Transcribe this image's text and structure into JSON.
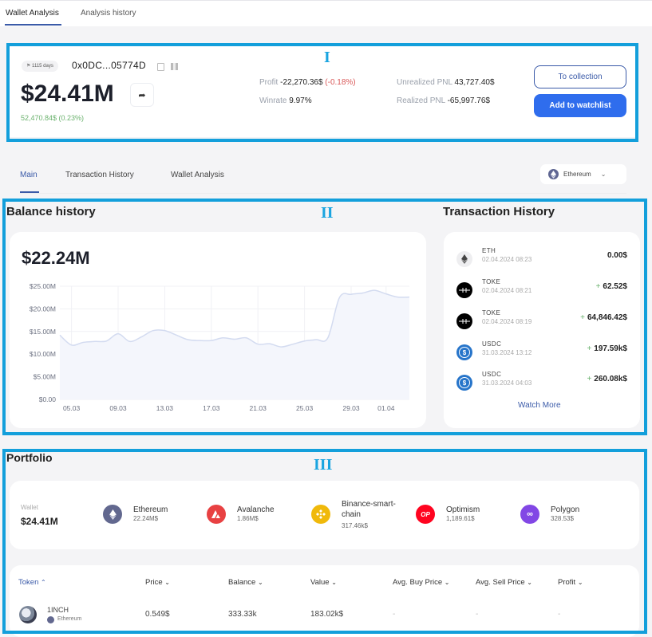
{
  "top_tabs": [
    {
      "label": "Wallet Analysis",
      "active": true
    },
    {
      "label": "Analysis history",
      "active": false
    }
  ],
  "annotations": {
    "section1": "I",
    "section2": "II",
    "section3": "III"
  },
  "wallet": {
    "age_badge": "1115 days",
    "address": "0x0DC...05774D",
    "balance": "$24.41M",
    "change": "52,470.84$ (0.23%)",
    "profit_label": "Profit",
    "profit_value": "-22,270.36$",
    "profit_pct": "(-0.18%)",
    "winrate_label": "Winrate",
    "winrate_value": "9.97%",
    "unrealized_label": "Unrealized PNL",
    "unrealized_value": "43,727.40$",
    "realized_label": "Realized PNL",
    "realized_value": "-65,997.76$",
    "to_collection": "To collection",
    "add_watchlist": "Add to watchlist"
  },
  "sub_tabs": [
    {
      "label": "Main",
      "active": true
    },
    {
      "label": "Transaction History",
      "active": false
    },
    {
      "label": "Wallet Analysis",
      "active": false
    }
  ],
  "chain_selector": {
    "selected": "Ethereum"
  },
  "balance_history": {
    "title": "Balance history",
    "current_value": "$22.24M"
  },
  "chart_data": {
    "type": "area",
    "title": "Balance history",
    "xlabel": "",
    "ylabel": "",
    "ylim": [
      0,
      25
    ],
    "y_ticks": [
      "$0.00",
      "$5.00M",
      "$10.00M",
      "$15.00M",
      "$20.00M",
      "$25.00M"
    ],
    "x_ticks": [
      "05.03",
      "09.03",
      "13.03",
      "17.03",
      "21.03",
      "25.03",
      "29.03",
      "01.04"
    ],
    "grid": true,
    "series": [
      {
        "name": "Balance ($M)",
        "x": [
          "04.03",
          "05.03",
          "06.03",
          "07.03",
          "08.03",
          "09.03",
          "10.03",
          "11.03",
          "12.03",
          "13.03",
          "14.03",
          "15.03",
          "16.03",
          "17.03",
          "18.03",
          "19.03",
          "20.03",
          "21.03",
          "22.03",
          "23.03",
          "24.03",
          "25.03",
          "26.03",
          "27.03",
          "28.03",
          "29.03",
          "30.03",
          "31.03",
          "01.04",
          "02.04",
          "03.04"
        ],
        "values": [
          14.2,
          12.0,
          12.6,
          12.8,
          12.9,
          14.5,
          12.8,
          13.8,
          15.2,
          15.2,
          14.2,
          13.2,
          13.0,
          13.0,
          13.6,
          13.3,
          13.6,
          12.2,
          12.3,
          11.6,
          12.2,
          12.9,
          13.2,
          13.6,
          22.5,
          23.2,
          23.5,
          24.1,
          23.3,
          22.6,
          22.6
        ]
      }
    ]
  },
  "tx_history": {
    "title": "Transaction History",
    "items": [
      {
        "symbol": "ETH",
        "date": "02.04.2024 08:23",
        "amount": "0.00$",
        "plus": "",
        "icon": "ethereum-icon"
      },
      {
        "symbol": "TOKE",
        "date": "02.04.2024 08:21",
        "amount": "62.52$",
        "plus": "+",
        "icon": "toke-icon"
      },
      {
        "symbol": "TOKE",
        "date": "02.04.2024 08:19",
        "amount": "64,846.42$",
        "plus": "+",
        "icon": "toke-icon"
      },
      {
        "symbol": "USDC",
        "date": "31.03.2024 13:12",
        "amount": "197.59k$",
        "plus": "+",
        "icon": "usdc-icon"
      },
      {
        "symbol": "USDC",
        "date": "31.03.2024 04:03",
        "amount": "260.08k$",
        "plus": "+",
        "icon": "usdc-icon"
      }
    ],
    "watch_more": "Watch More"
  },
  "portfolio": {
    "title": "Portfolio",
    "wallet_label": "Wallet",
    "wallet_value": "$24.41M",
    "chains": [
      {
        "name": "Ethereum",
        "value": "22.24M$",
        "color": "#62688f"
      },
      {
        "name": "Avalanche",
        "value": "1.86M$",
        "color": "#e84142"
      },
      {
        "name": "Binance-smart-chain",
        "value": "317.46k$",
        "color": "#f0b90b"
      },
      {
        "name": "Optimism",
        "value": "1,189.61$",
        "color": "#ff0420",
        "glyph": "OP"
      },
      {
        "name": "Polygon",
        "value": "328.53$",
        "color": "#8247e5"
      }
    ]
  },
  "table": {
    "columns": [
      {
        "label": "Token",
        "sort": "^"
      },
      {
        "label": "Price",
        "sort": "v"
      },
      {
        "label": "Balance",
        "sort": "v"
      },
      {
        "label": "Value",
        "sort": "v"
      },
      {
        "label": "Avg. Buy Price",
        "sort": "v"
      },
      {
        "label": "Avg. Sell Price",
        "sort": "v"
      },
      {
        "label": "Profit",
        "sort": "v"
      }
    ],
    "rows": [
      {
        "token": "1INCH",
        "chain": "Ethereum",
        "price": "0.549$",
        "balance": "333.33k",
        "value": "183.02k$",
        "avg_buy": "-",
        "avg_sell": "-",
        "profit": "-"
      }
    ]
  }
}
